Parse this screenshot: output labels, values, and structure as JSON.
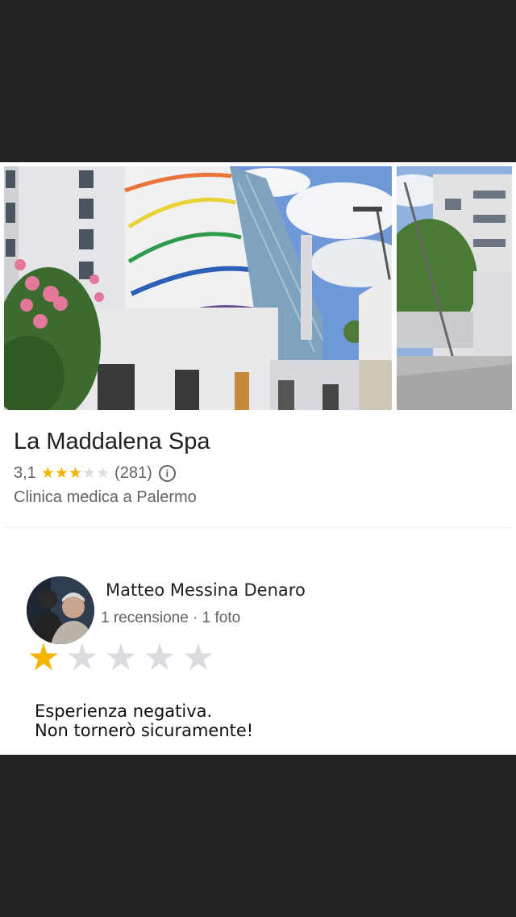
{
  "place": {
    "name": "La Maddalena Spa",
    "rating": "3,1",
    "rating_value": 3.1,
    "reviews_count": "(281)",
    "category": "Clinica medica a Palermo"
  },
  "review": {
    "author": "Matteo Messina Denaro",
    "meta": "1 recensione · 1 foto",
    "stars": 1,
    "max_stars": 5,
    "text_line1": "Esperienza negativa.",
    "text_line2": "Non tornerò sicuramente!"
  },
  "colors": {
    "star_on": "#f4b400",
    "star_off": "#dadce0",
    "background": "#232325"
  },
  "icons": {
    "info": "info-icon",
    "star": "star-icon"
  }
}
